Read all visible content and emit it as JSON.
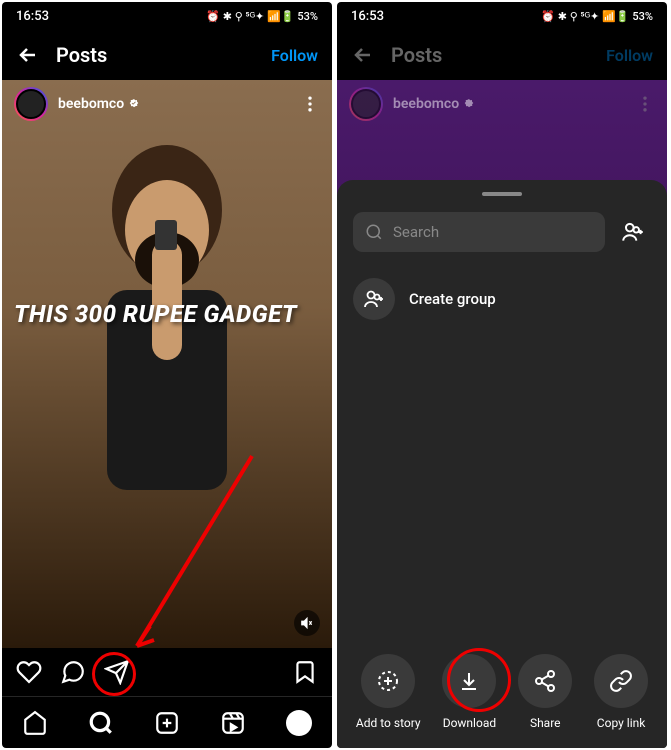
{
  "status": {
    "time": "16:53",
    "icons_text": "53%"
  },
  "left": {
    "header": {
      "title": "Posts",
      "follow": "Follow"
    },
    "post": {
      "username": "beebomco",
      "overlay_text": "THIS 300 RUPEE GADGET"
    }
  },
  "right": {
    "header": {
      "title": "Posts",
      "follow": "Follow"
    },
    "post": {
      "username": "beebomco"
    },
    "sheet": {
      "search_placeholder": "Search",
      "create_group": "Create group",
      "actions": [
        {
          "id": "add-to-story",
          "label": "Add to story"
        },
        {
          "id": "download",
          "label": "Download"
        },
        {
          "id": "share",
          "label": "Share"
        },
        {
          "id": "copy-link",
          "label": "Copy link"
        }
      ]
    }
  }
}
